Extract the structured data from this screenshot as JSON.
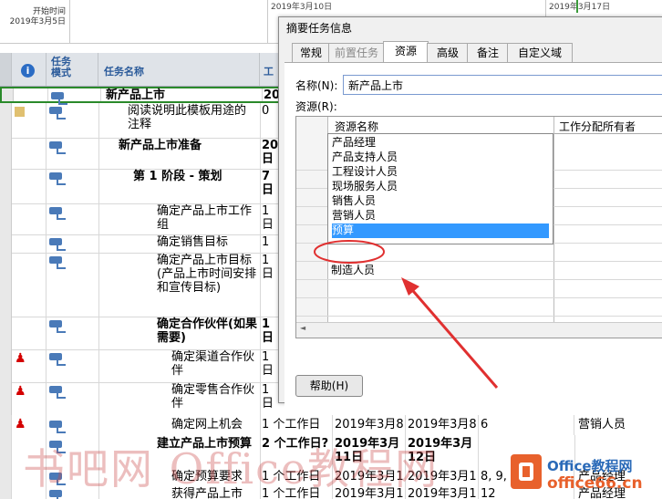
{
  "timescale": {
    "start_label": "开始时间",
    "start_date": "2019年3月5日",
    "week_labels": [
      "2019年3月10日",
      "2019年3月17日"
    ]
  },
  "grid": {
    "info_header": "i",
    "mode_header": "任务\n模式",
    "name_header": "任务名称",
    "dur_header": "工",
    "rows": [
      {
        "indicator": "",
        "name": "新产品上市",
        "bold": true,
        "dur": "20",
        "level": 0,
        "selected": true
      },
      {
        "indicator": "note",
        "name": "阅读说明此模板用途的注释",
        "bold": false,
        "dur": "0",
        "level": 1
      },
      {
        "indicator": "",
        "name": "新产品上市准备",
        "bold": true,
        "dur": "20日",
        "level": 1
      },
      {
        "indicator": "",
        "name": "第 1 阶段 - 策划",
        "bold": true,
        "dur": "7日",
        "level": 2
      },
      {
        "indicator": "",
        "name": "确定产品上市工作组",
        "bold": false,
        "dur": "1日",
        "level": 3
      },
      {
        "indicator": "",
        "name": "确定销售目标",
        "bold": false,
        "dur": "1",
        "level": 3
      },
      {
        "indicator": "",
        "name": "确定产品上市目标(产品上市时间安排和宣传目标)",
        "bold": false,
        "dur": "1日",
        "level": 3
      },
      {
        "indicator": "",
        "name": "确定合作伙伴(如果需要)",
        "bold": true,
        "dur": "1日",
        "level": 3
      },
      {
        "indicator": "person",
        "name": "确定渠道合作伙伴",
        "bold": false,
        "dur": "1日",
        "level": 4
      },
      {
        "indicator": "person",
        "name": "确定零售合作伙伴",
        "bold": false,
        "dur": "1日",
        "level": 4
      },
      {
        "indicator": "person",
        "name": "确定网上机会",
        "bold": false,
        "dur": "1 个工作日",
        "level": 4
      },
      {
        "indicator": "",
        "name": "建立产品上市预算",
        "bold": true,
        "dur": "2 个工作日?",
        "level": 3
      },
      {
        "indicator": "",
        "name": "确定预算要求",
        "bold": false,
        "dur": "1 个工作日",
        "level": 4
      },
      {
        "indicator": "",
        "name": "获得产品上市",
        "bold": false,
        "dur": "1 个工作日",
        "level": 4
      }
    ],
    "extra_cols": [
      {
        "start": "2019年3月8",
        "finish": "2019年3月8",
        "pred": "6",
        "resource": "营销人员"
      },
      {
        "start": "2019年3月11日",
        "finish": "2019年3月12日",
        "pred": "",
        "resource": ""
      },
      {
        "start": "2019年3月1",
        "finish": "2019年3月1",
        "pred": "8, 9,",
        "resource": "产品经理"
      },
      {
        "start": "2019年3月1",
        "finish": "2019年3月1",
        "pred": "12",
        "resource": "产品经理"
      }
    ]
  },
  "dialog": {
    "title": "摘要任务信息",
    "tabs": [
      "常规",
      "前置任务",
      "资源",
      "高级",
      "备注",
      "自定义域"
    ],
    "active_tab": "资源",
    "name_label": "名称(N):",
    "name_value": "新产品上市",
    "resources_label": "资源(R):",
    "col_resource_name": "资源名称",
    "col_assignment_owner": "工作分配所有者",
    "dropdown_items": [
      "产品经理",
      "产品支持人员",
      "工程设计人员",
      "现场服务人员",
      "销售人员",
      "营销人员",
      "预算",
      "制造人员"
    ],
    "selected_item": "预算",
    "help_button": "帮助(H)"
  },
  "watermark": "书吧网 Office教程网",
  "logo": {
    "line1": "Office教程网",
    "line2": "office66.cn"
  },
  "colors": {
    "accent": "#3399ff",
    "annotation": "#e03030"
  }
}
